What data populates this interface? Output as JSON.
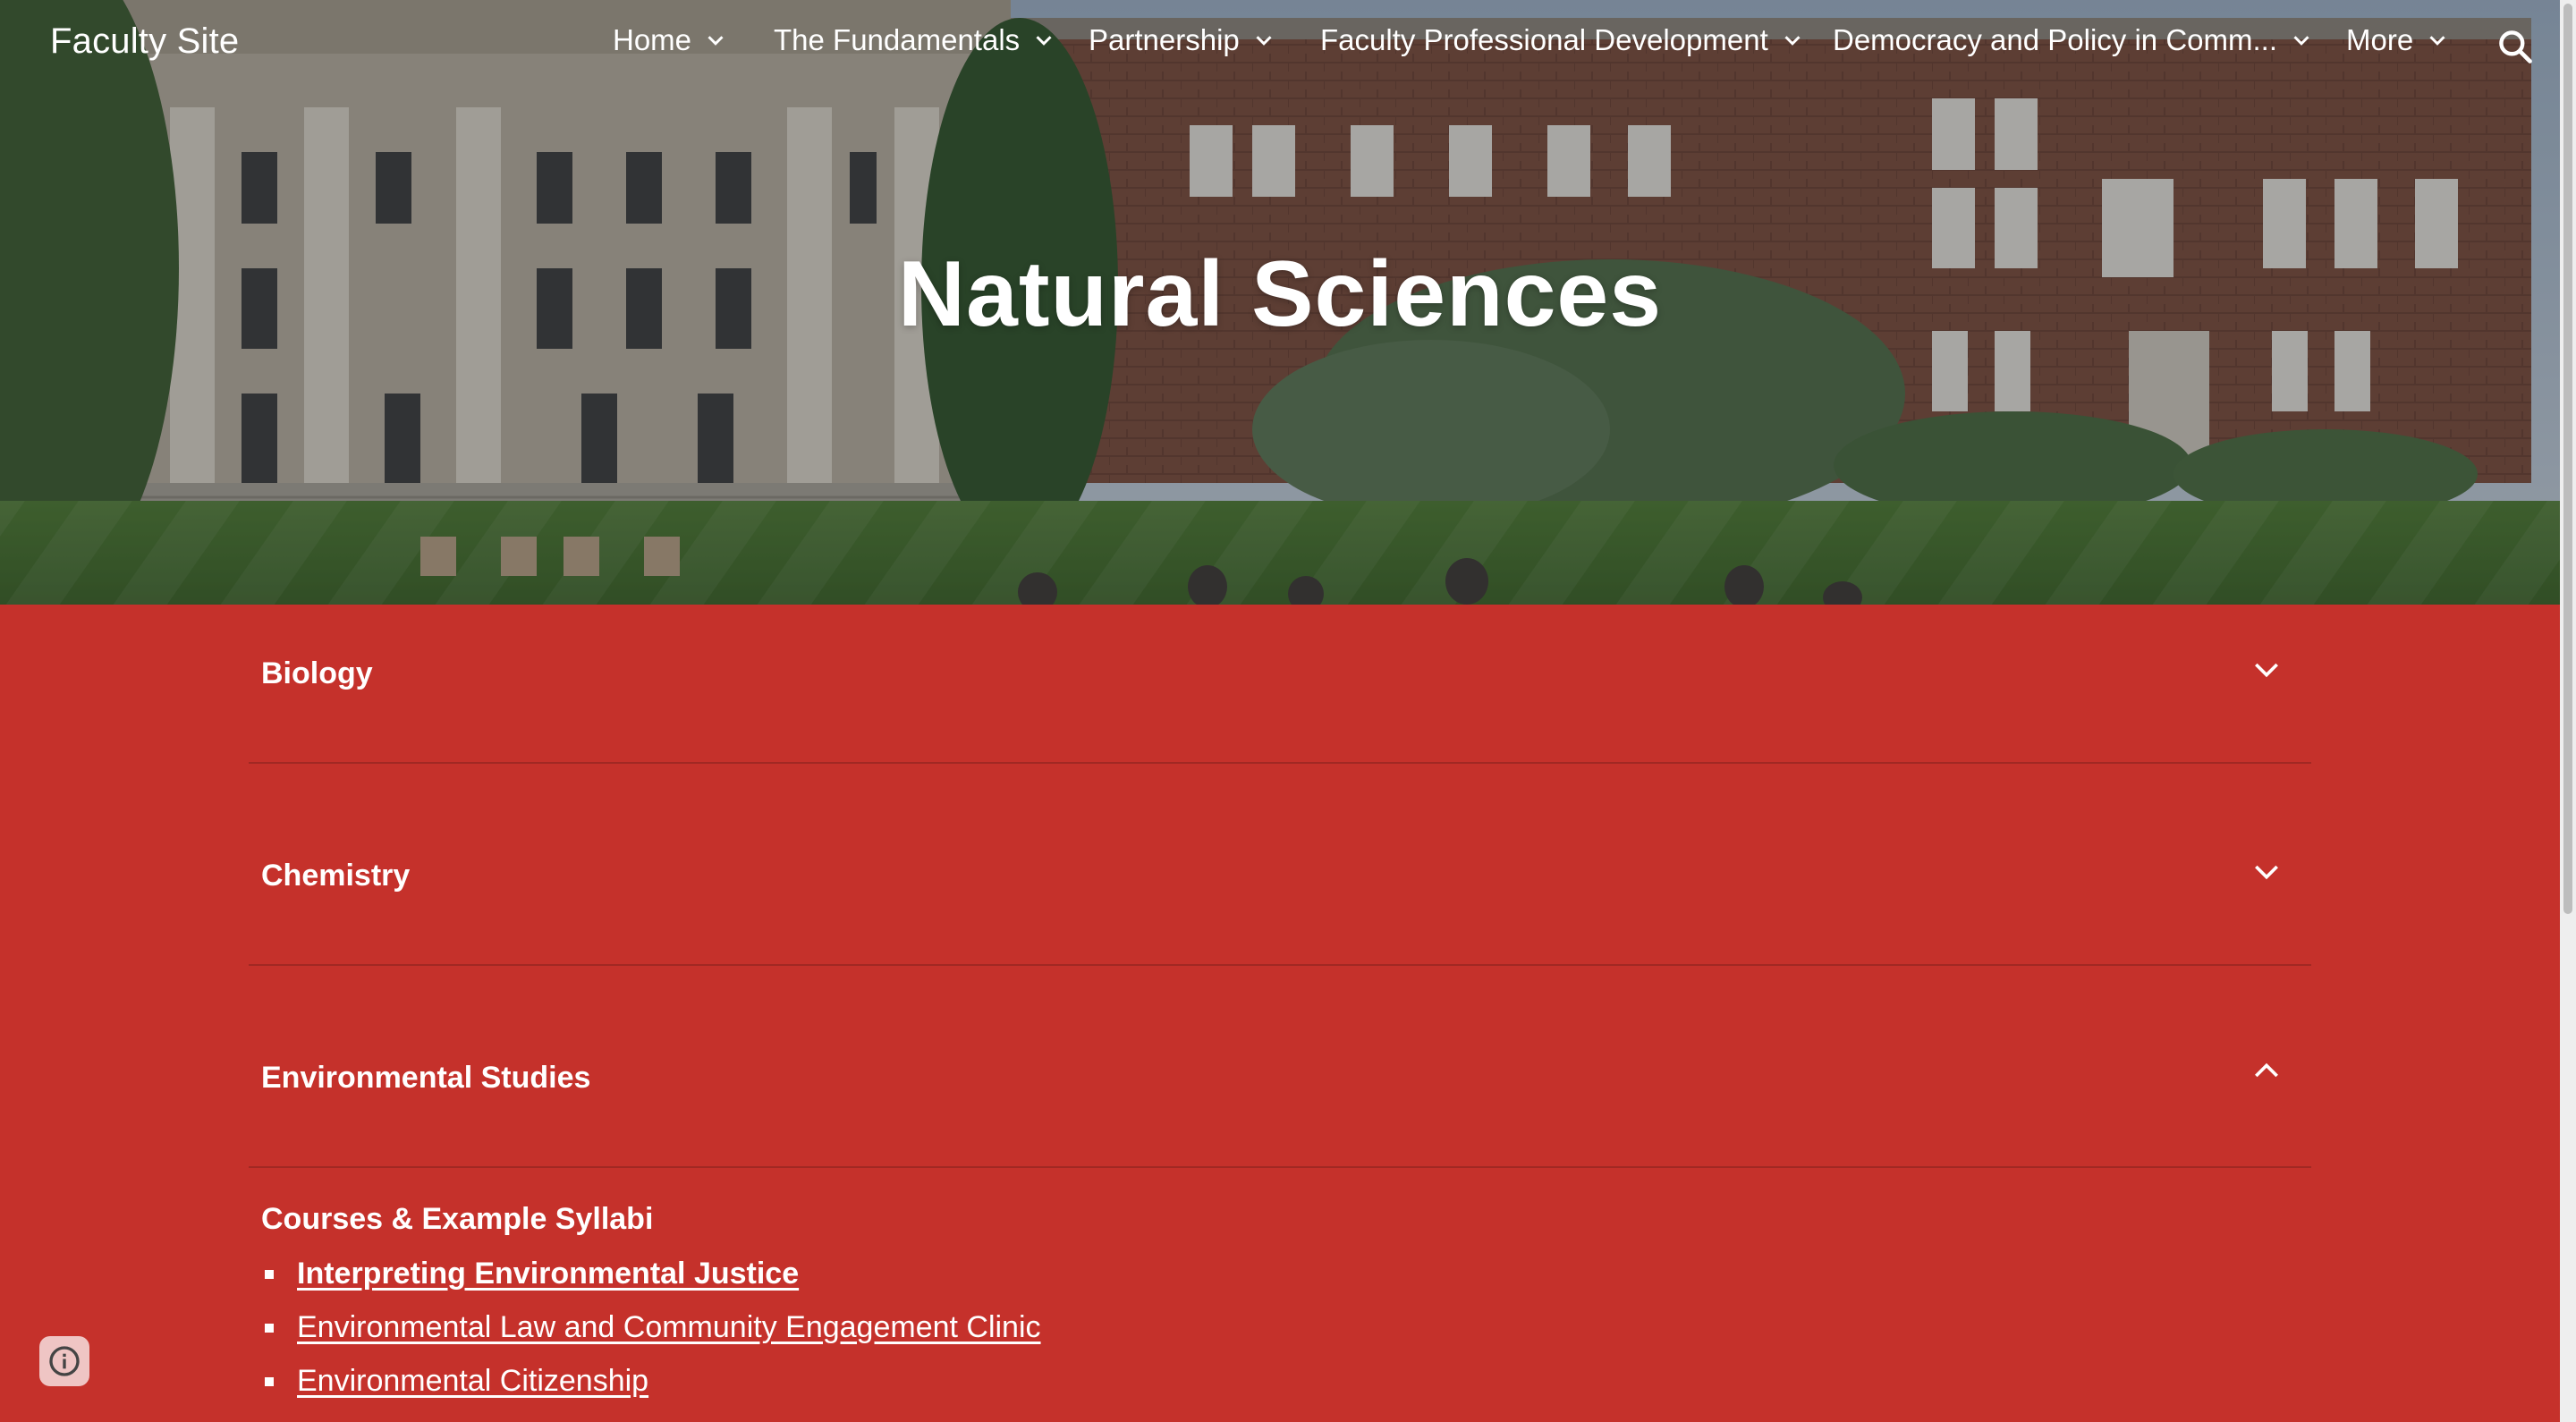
{
  "header": {
    "site_title": "Faculty Site",
    "nav": [
      {
        "label": "Home"
      },
      {
        "label": "The Fundamentals"
      },
      {
        "label": "Partnership"
      },
      {
        "label": "Faculty Professional Development"
      },
      {
        "label": "Democracy and Policy in Comm..."
      },
      {
        "label": "More"
      }
    ],
    "search_icon": "search-icon"
  },
  "hero": {
    "title": "Natural Sciences"
  },
  "accordion": [
    {
      "title": "Biology",
      "expanded": false,
      "icon": "chevron-down-icon"
    },
    {
      "title": "Chemistry",
      "expanded": false,
      "icon": "chevron-down-icon"
    },
    {
      "title": "Environmental Studies",
      "expanded": true,
      "icon": "chevron-up-icon"
    }
  ],
  "env_section": {
    "heading": "Courses & Example Syllabi",
    "links": [
      "Interpreting Environmental Justice",
      "Environmental Law and Community Engagement Clinic",
      "Environmental Citizenship"
    ]
  },
  "colors": {
    "content_bg": "#c5312b",
    "text": "#ffffff"
  },
  "info_icon": "info-icon"
}
